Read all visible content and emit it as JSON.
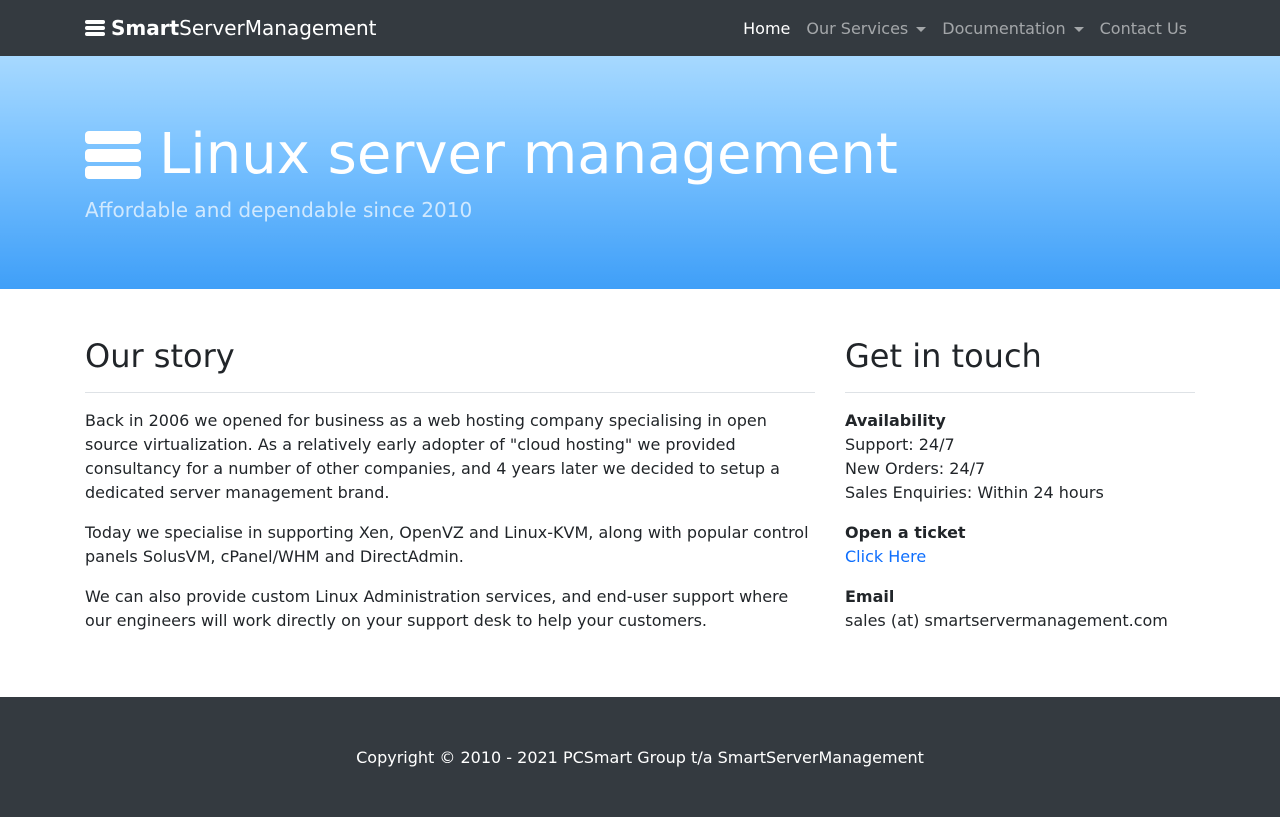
{
  "navbar": {
    "brand_bold": "Smart",
    "brand_rest": "ServerManagement",
    "brand_icon": "server-icon",
    "links": [
      {
        "label": "Home",
        "active": true,
        "dropdown": false
      },
      {
        "label": "Our Services",
        "active": false,
        "dropdown": true
      },
      {
        "label": "Documentation",
        "active": false,
        "dropdown": true
      },
      {
        "label": "Contact Us",
        "active": false,
        "dropdown": false
      }
    ]
  },
  "hero": {
    "title": "Linux server management",
    "subtitle": "Affordable and dependable since 2010",
    "icon": "server-icon"
  },
  "story": {
    "heading": "Our story",
    "paragraphs": [
      "Back in 2006 we opened for business as a web hosting company specialising in open source virtualization. As a relatively early adopter of \"cloud hosting\" we provided consultancy for a number of other companies, and 4 years later we decided to setup a dedicated server management brand.",
      "Today we specialise in supporting Xen, OpenVZ and Linux-KVM, along with popular control panels SolusVM, cPanel/WHM and DirectAdmin.",
      "We can also provide custom Linux Administration services, and end-user support where our engineers will work directly on your support desk to help your customers."
    ]
  },
  "contact": {
    "heading": "Get in touch",
    "availability": {
      "label": "Availability",
      "lines": [
        "Support: 24/7",
        "New Orders: 24/7",
        "Sales Enquiries: Within 24 hours"
      ]
    },
    "ticket": {
      "label": "Open a ticket",
      "link_text": "Click Here"
    },
    "email": {
      "label": "Email",
      "value": "sales (at) smartservermanagement.com"
    }
  },
  "footer": {
    "copyright": "Copyright © 2010 - 2021 PCSmart Group t/a SmartServerManagement"
  },
  "colors": {
    "navbar_bg": "#343a40",
    "hero_top": "#a7d9ff",
    "hero_bottom": "#3f9ff8",
    "link": "#0d6efd"
  }
}
